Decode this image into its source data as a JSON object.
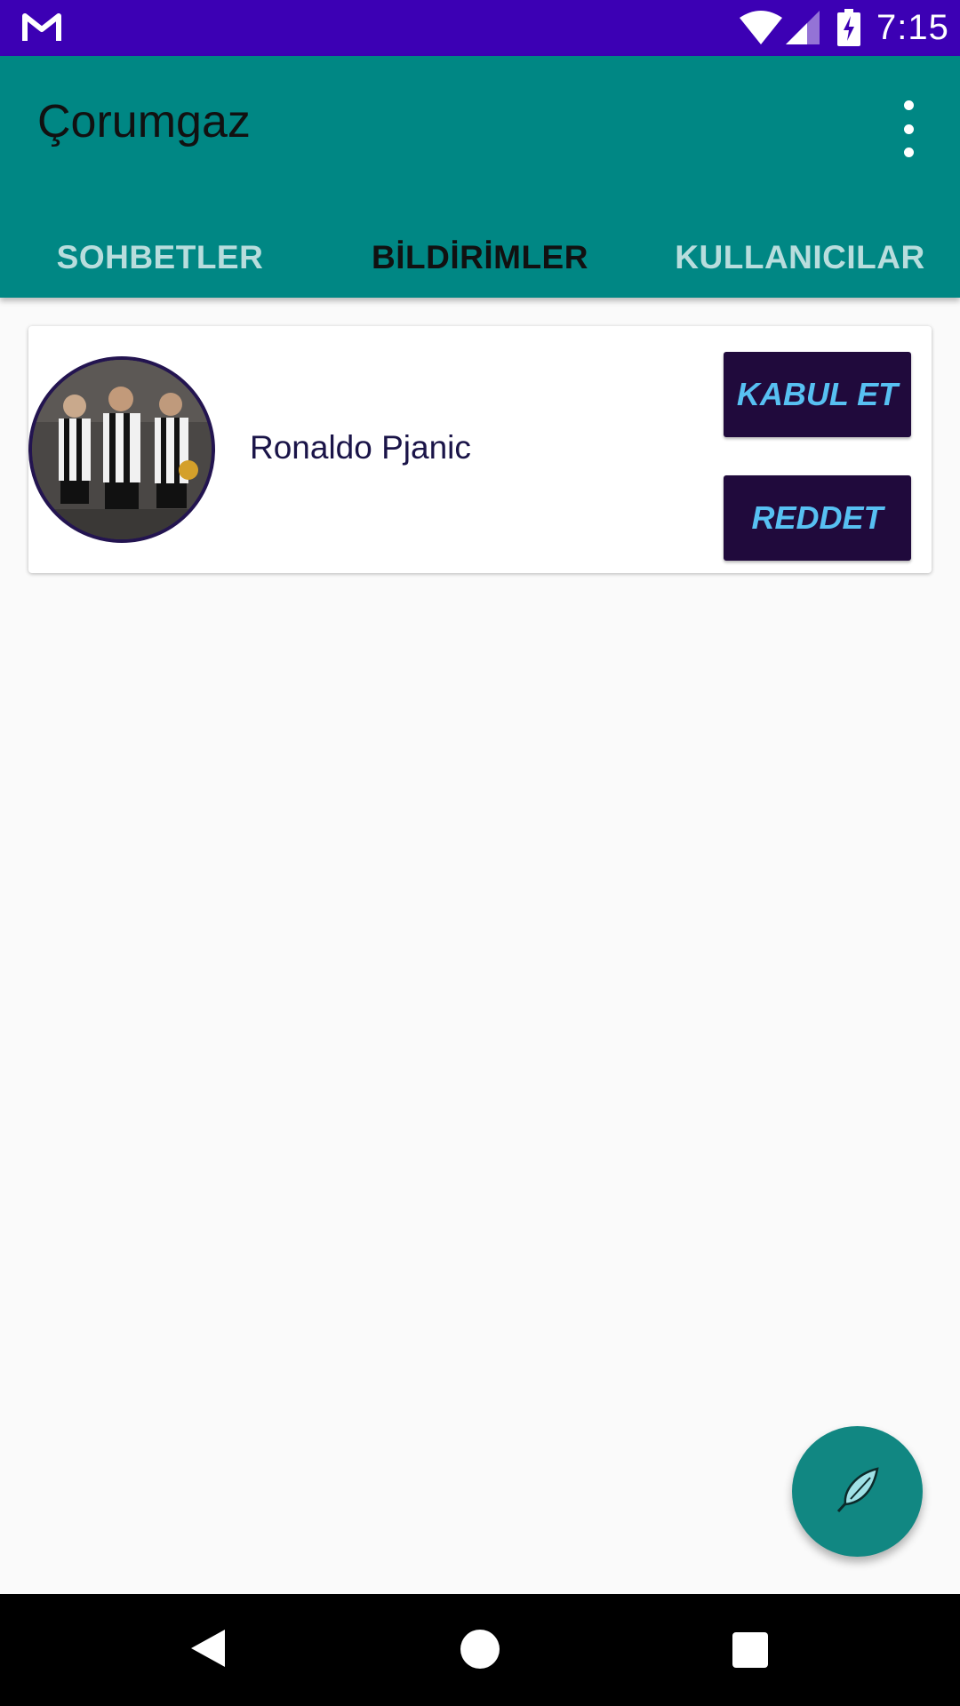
{
  "status_bar": {
    "time": "7:15",
    "icons": [
      "gmail-icon",
      "wifi-icon",
      "signal-icon",
      "battery-charging-icon"
    ]
  },
  "app_bar": {
    "title": "Çorumgaz",
    "overflow_icon": "more-vert-icon"
  },
  "tabs": [
    {
      "label": "SOHBETLER",
      "active": false
    },
    {
      "label": "BİLDİRİMLER",
      "active": true
    },
    {
      "label": "KULLANICILAR",
      "active": false
    }
  ],
  "requests": [
    {
      "name": "Ronaldo Pjanic",
      "avatar_icon": "profile-photo",
      "accept_label": "KABUL ET",
      "reject_label": "REDDET"
    }
  ],
  "fab": {
    "icon": "feather-icon"
  },
  "nav_bar": {
    "icons": [
      "back-icon",
      "home-icon",
      "recents-icon"
    ]
  },
  "colors": {
    "status_bar": "#3c00b4",
    "app_bar": "#008784",
    "button_bg": "#200a3c",
    "button_text": "#57c0f2",
    "fab": "#118782"
  }
}
